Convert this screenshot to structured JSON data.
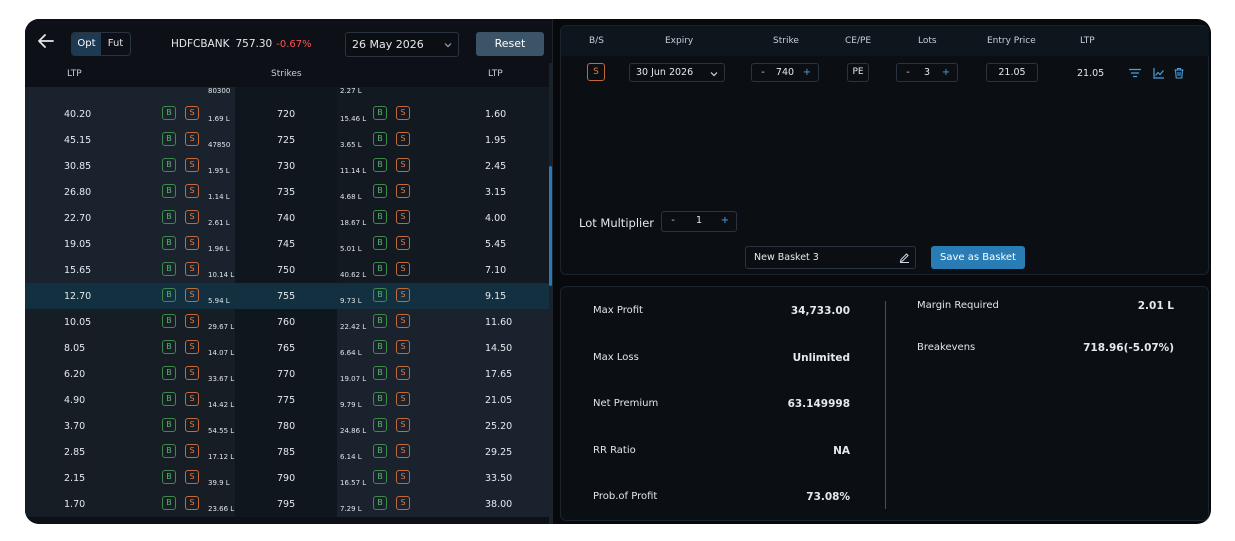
{
  "header": {
    "mode_opt": "Opt",
    "mode_fut": "Fut",
    "symbol": "HDFCBANK",
    "price": "757.30",
    "change": "-0.67%",
    "expiry": "26 May 2026",
    "reset_label": "Reset"
  },
  "chain_headers": {
    "ltp_left": "LTP",
    "strikes": "Strikes",
    "ltp_right": "LTP"
  },
  "top_partial": {
    "oi_left": "80300",
    "oi_right": "2.27 L"
  },
  "chain_rows": [
    {
      "ce_ltp": "40.20",
      "ce_oi": "1.69 L",
      "strike": "720",
      "pe_oi": "15.46 L",
      "pe_ltp": "1.60"
    },
    {
      "ce_ltp": "45.15",
      "ce_oi": "47850",
      "strike": "725",
      "pe_oi": "3.65 L",
      "pe_ltp": "1.95"
    },
    {
      "ce_ltp": "30.85",
      "ce_oi": "1.95 L",
      "strike": "730",
      "pe_oi": "11.14 L",
      "pe_ltp": "2.45"
    },
    {
      "ce_ltp": "26.80",
      "ce_oi": "1.14 L",
      "strike": "735",
      "pe_oi": "4.68 L",
      "pe_ltp": "3.15"
    },
    {
      "ce_ltp": "22.70",
      "ce_oi": "2.61 L",
      "strike": "740",
      "pe_oi": "18.67 L",
      "pe_ltp": "4.00"
    },
    {
      "ce_ltp": "19.05",
      "ce_oi": "1.96 L",
      "strike": "745",
      "pe_oi": "5.01 L",
      "pe_ltp": "5.45"
    },
    {
      "ce_ltp": "15.65",
      "ce_oi": "10.14 L",
      "strike": "750",
      "pe_oi": "40.62 L",
      "pe_ltp": "7.10"
    },
    {
      "ce_ltp": "12.70",
      "ce_oi": "5.94 L",
      "strike": "755",
      "pe_oi": "9.73 L",
      "pe_ltp": "9.15"
    },
    {
      "ce_ltp": "10.05",
      "ce_oi": "29.67 L",
      "strike": "760",
      "pe_oi": "22.42 L",
      "pe_ltp": "11.60"
    },
    {
      "ce_ltp": "8.05",
      "ce_oi": "14.07 L",
      "strike": "765",
      "pe_oi": "6.64 L",
      "pe_ltp": "14.50"
    },
    {
      "ce_ltp": "6.20",
      "ce_oi": "33.67 L",
      "strike": "770",
      "pe_oi": "19.07 L",
      "pe_ltp": "17.65"
    },
    {
      "ce_ltp": "4.90",
      "ce_oi": "14.42 L",
      "strike": "775",
      "pe_oi": "9.79 L",
      "pe_ltp": "21.05"
    },
    {
      "ce_ltp": "3.70",
      "ce_oi": "54.55 L",
      "strike": "780",
      "pe_oi": "24.86 L",
      "pe_ltp": "25.20"
    },
    {
      "ce_ltp": "2.85",
      "ce_oi": "17.12 L",
      "strike": "785",
      "pe_oi": "6.14 L",
      "pe_ltp": "29.25"
    },
    {
      "ce_ltp": "2.15",
      "ce_oi": "39.9 L",
      "strike": "790",
      "pe_oi": "16.57 L",
      "pe_ltp": "33.50"
    },
    {
      "ce_ltp": "1.70",
      "ce_oi": "23.66 L",
      "strike": "795",
      "pe_oi": "7.29 L",
      "pe_ltp": "38.00"
    }
  ],
  "buy_label": "B",
  "sell_label": "S",
  "position_headers": {
    "bs": "B/S",
    "expiry": "Expiry",
    "strike": "Strike",
    "cepe": "CE/PE",
    "lots": "Lots",
    "entry_price": "Entry Price",
    "ltp": "LTP"
  },
  "leg": {
    "bs": "S",
    "expiry": "30 Jun 2026",
    "strike": "740",
    "cepe": "PE",
    "lots": "3",
    "entry_price": "21.05",
    "ltp": "21.05",
    "minus": "-",
    "plus": "+"
  },
  "lot_multiplier": {
    "label": "Lot Multiplier",
    "value": "1",
    "minus": "-",
    "plus": "+"
  },
  "basket": {
    "name": "New Basket 3",
    "save_label": "Save as Basket"
  },
  "metrics_left": [
    {
      "label": "Max Profit",
      "value": "34,733.00"
    },
    {
      "label": "Max Loss",
      "value": "Unlimited"
    },
    {
      "label": "Net Premium",
      "value": "63.149998"
    },
    {
      "label": "RR Ratio",
      "value": "NA"
    },
    {
      "label": "Prob.of Profit",
      "value": "73.08%"
    }
  ],
  "metrics_right": [
    {
      "label": "Margin Required",
      "value": "2.01 L"
    },
    {
      "label": "Breakevens",
      "value": "718.96(-5.07%)"
    }
  ],
  "colors": {
    "accent": "#2a7cb4",
    "negative": "#ff5252",
    "buy": "#55b867",
    "sell": "#e8783f"
  }
}
